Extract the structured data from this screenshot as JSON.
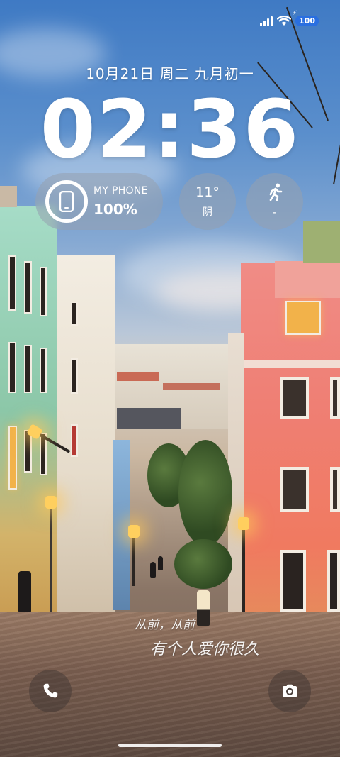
{
  "status_bar": {
    "battery": "100",
    "icons": [
      "signal-icon",
      "wifi-icon",
      "battery-icon"
    ]
  },
  "lock_screen": {
    "date": "10月21日 周二 九月初一",
    "time": "02:36"
  },
  "widgets": {
    "phone": {
      "label": "MY PHONE",
      "value": "100%",
      "icon": "phone-icon"
    },
    "weather": {
      "temperature": "11°",
      "condition": "阴"
    },
    "steps": {
      "icon": "running-icon",
      "value": "-"
    }
  },
  "caption": {
    "line1": "从前，从前",
    "line2": "有个人爱你很久"
  },
  "shortcuts": {
    "left": "phone-call-icon",
    "right": "camera-icon"
  }
}
